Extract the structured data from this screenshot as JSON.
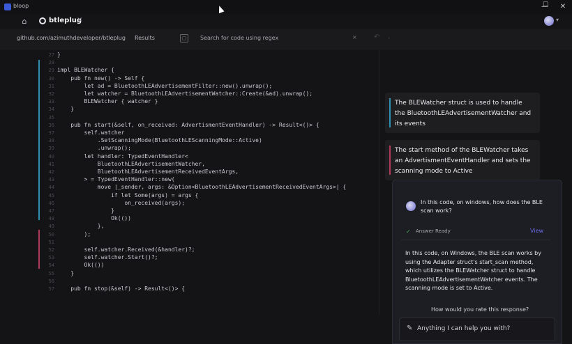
{
  "window": {
    "app_name": "bloop",
    "minimize": "—",
    "maximize": "☐",
    "close": "✕"
  },
  "tab": {
    "label": "btleplug",
    "close": "×"
  },
  "nav": {
    "repo_path": "github.com/azimuthdeveloper/btleplug",
    "results": "Results",
    "search_placeholder": "Search for code using regex",
    "clear": "×"
  },
  "code": {
    "lines": [
      {
        "n": "27",
        "t": "}"
      },
      {
        "n": "28",
        "t": ""
      },
      {
        "n": "29",
        "t": "impl BLEWatcher {"
      },
      {
        "n": "30",
        "t": "    pub fn new() -> Self {"
      },
      {
        "n": "31",
        "t": "        let ad = BluetoothLEAdvertisementFilter::new().unwrap();"
      },
      {
        "n": "32",
        "t": "        let watcher = BluetoothLEAdvertisementWatcher::Create(&ad).unwrap();"
      },
      {
        "n": "33",
        "t": "        BLEWatcher { watcher }"
      },
      {
        "n": "34",
        "t": "    }"
      },
      {
        "n": "35",
        "t": ""
      },
      {
        "n": "36",
        "t": "    pub fn start(&self, on_received: AdvertismentEventHandler) -> Result<()> {"
      },
      {
        "n": "37",
        "t": "        self.watcher"
      },
      {
        "n": "38",
        "t": "            .SetScanningMode(BluetoothLEScanningMode::Active)"
      },
      {
        "n": "39",
        "t": "            .unwrap();"
      },
      {
        "n": "40",
        "t": "        let handler: TypedEventHandler<"
      },
      {
        "n": "41",
        "t": "            BluetoothLEAdvertisementWatcher,"
      },
      {
        "n": "42",
        "t": "            BluetoothLEAdvertisementReceivedEventArgs,"
      },
      {
        "n": "43",
        "t": "        > = TypedEventHandler::new("
      },
      {
        "n": "44",
        "t": "            move |_sender, args: &Option<BluetoothLEAdvertisementReceivedEventArgs>| {"
      },
      {
        "n": "45",
        "t": "                if let Some(args) = args {"
      },
      {
        "n": "46",
        "t": "                    on_received(args);"
      },
      {
        "n": "47",
        "t": "                }"
      },
      {
        "n": "48",
        "t": "                Ok(())"
      },
      {
        "n": "49",
        "t": "            },"
      },
      {
        "n": "50",
        "t": "        );"
      },
      {
        "n": "51",
        "t": ""
      },
      {
        "n": "52",
        "t": "        self.watcher.Received(&handler)?;"
      },
      {
        "n": "53",
        "t": "        self.watcher.Start()?;"
      },
      {
        "n": "54",
        "t": "        Ok(())"
      },
      {
        "n": "55",
        "t": "    }"
      },
      {
        "n": "56",
        "t": ""
      },
      {
        "n": "57",
        "t": "    pub fn stop(&self) -> Result<()> {"
      }
    ]
  },
  "annotations": [
    {
      "text": "The BLEWatcher struct is used to handle the BluetoothLEAdvertisementWatcher and its events",
      "accent": "#2f8fb0"
    },
    {
      "text": "The start method of the BLEWatcher takes an AdvertismentEventHandler and sets the scanning mode to Active",
      "accent": "#b03a5a"
    }
  ],
  "chat": {
    "question": "In this code, on windows, how does the BLE scan work?",
    "status": "Answer Ready",
    "view_label": "View",
    "answer": "In this code, on Windows, the BLE scan works by using the Adapter struct's start_scan method, which utilizes the BLEWatcher struct to handle BluetoothLEAdvertisementWatcher events. The scanning mode is set to Active.",
    "rate_prompt": "How would you rate this response?",
    "input_placeholder": "Anything I can help you with?"
  },
  "colors": {
    "blue_accent": "#2f8fb0",
    "pink_accent": "#b03a5a",
    "link": "#6a6ae6"
  }
}
